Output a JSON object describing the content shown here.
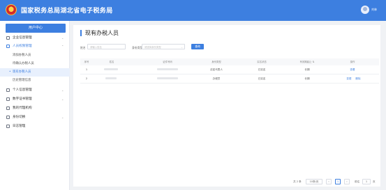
{
  "header": {
    "title": "国家税务总局湖北省电子税务局",
    "user_name": "刘林"
  },
  "sidebar": {
    "user_center": "用户中心",
    "items": [
      {
        "label": "企业信息管理",
        "icon": "building-icon",
        "chevron": "⌄"
      },
      {
        "label": "人员权限管理",
        "icon": "people-icon",
        "chevron": "⌃"
      },
      {
        "label": "个人信息管理",
        "icon": "person-icon",
        "chevron": "⌄"
      },
      {
        "label": "数字证书管理",
        "icon": "certificate-icon",
        "chevron": "⌄"
      },
      {
        "label": "我的代理机构",
        "icon": "agency-icon",
        "chevron": ""
      },
      {
        "label": "身份切换",
        "icon": "switch-icon",
        "chevron": "⌄"
      },
      {
        "label": "日志管理",
        "icon": "log-icon",
        "chevron": ""
      }
    ],
    "sub_items": [
      {
        "label": "添加办税人员"
      },
      {
        "label": "待确认办税人员"
      },
      {
        "label": "现有办税人员"
      },
      {
        "label": "历史管理信息"
      }
    ]
  },
  "main": {
    "title": "现有办税人员",
    "filters": {
      "name_label": "姓名",
      "name_placeholder": "请输入姓名",
      "identity_label": "身份类型",
      "identity_placeholder": "请选择身份类型",
      "query_button": "查询"
    },
    "table": {
      "headers": [
        "序号",
        "姓名",
        "证件号码",
        "身份类型",
        "实名状态",
        "有效期起止",
        "操作"
      ],
      "sort_icon": "⇅",
      "rows": [
        {
          "index": "1",
          "identity": "法定代表人",
          "status": "已实名",
          "validity": "长期",
          "actions": [
            "查看"
          ]
        },
        {
          "index": "2",
          "identity": "办税员",
          "status": "已实名",
          "validity": "长期",
          "actions": [
            "变更",
            "删除"
          ]
        }
      ]
    },
    "pagination": {
      "total": "共 2 条",
      "page_size": "10条/页",
      "prev": "‹",
      "current_page": "1",
      "next": "›",
      "goto_label": "前往",
      "goto_value": "1",
      "page_unit": "页"
    }
  },
  "colors": {
    "brand": "#3d7fe0",
    "background": "#f0f2f5"
  }
}
